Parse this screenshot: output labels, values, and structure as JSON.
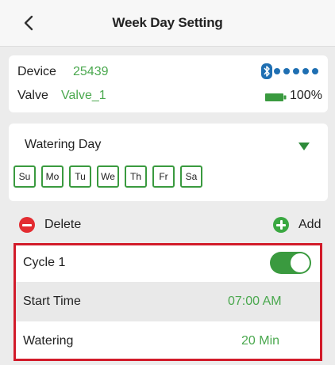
{
  "header": {
    "title": "Week Day Setting",
    "back_icon": "chevron-left-icon"
  },
  "device": {
    "label": "Device",
    "id": "25439",
    "valve_label": "Valve",
    "valve_name": "Valve_1",
    "battery": "100%",
    "signal_icon": "bluetooth-icon",
    "signal_strength": 5,
    "accent_color": "#4aa84e",
    "signal_color": "#1f6fb2"
  },
  "watering": {
    "label": "Watering Day",
    "dropdown_icon": "triangle-down-icon",
    "days": [
      "Su",
      "Mo",
      "Tu",
      "We",
      "Th",
      "Fr",
      "Sa"
    ]
  },
  "actions": {
    "delete_label": "Delete",
    "add_label": "Add",
    "delete_color": "#e32c31",
    "add_color": "#3aa841"
  },
  "cycle": {
    "name": "Cycle 1",
    "enabled": true,
    "start_time_label": "Start Time",
    "start_time": "07:00 AM",
    "watering_label": "Watering",
    "watering_duration": "20 Min",
    "highlight_color": "#d21b2a"
  }
}
